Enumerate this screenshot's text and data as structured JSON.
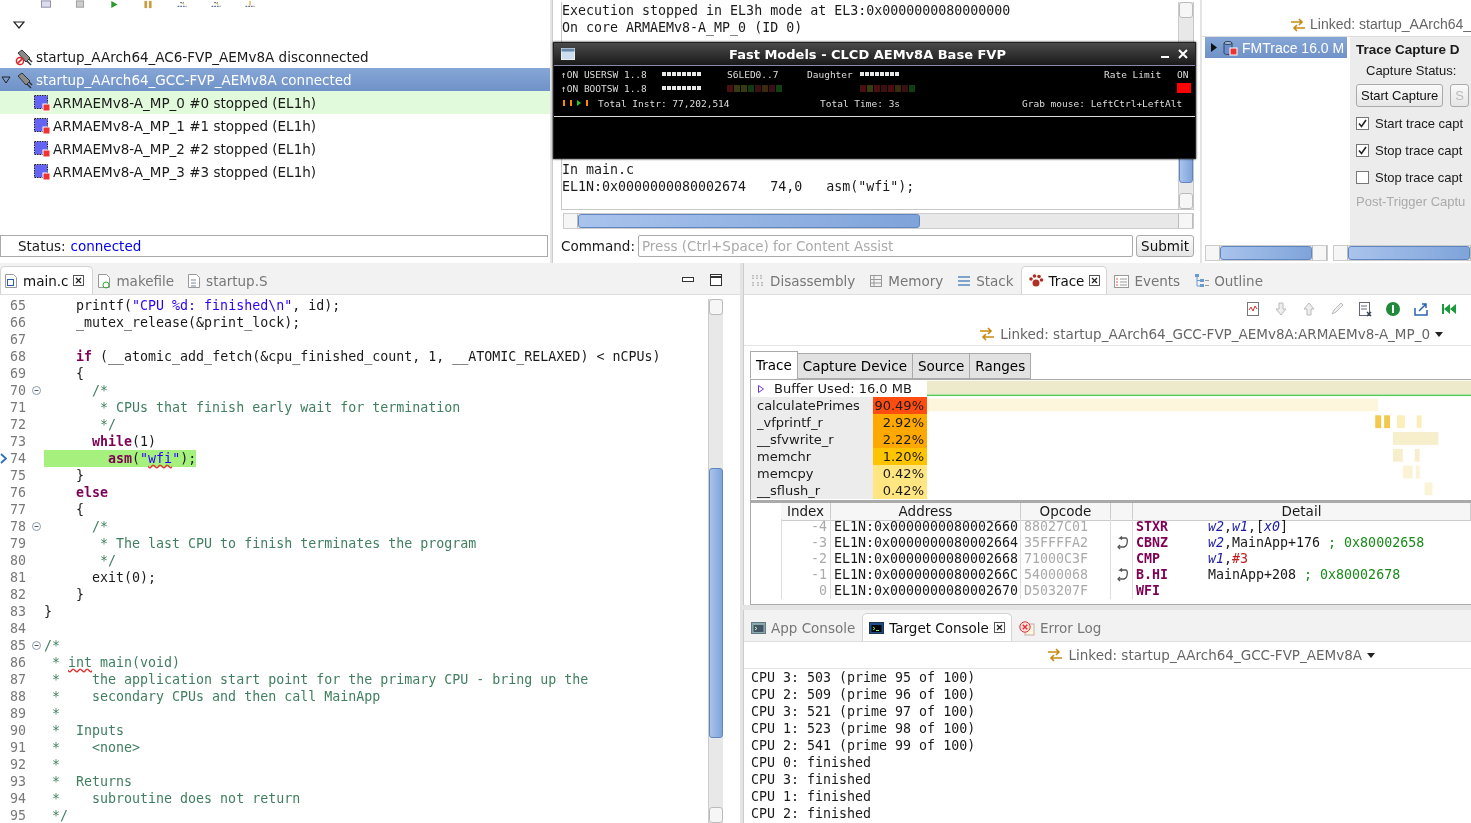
{
  "debug_control": {
    "connections": [
      {
        "name": "startup_AArch64_AC6-FVP_AEMv8A disconnected",
        "connected": false,
        "selected": false
      },
      {
        "name": "startup_AArch64_GCC-FVP_AEMv8A connected",
        "connected": true,
        "selected": true,
        "expanded": true,
        "children": [
          {
            "name": "ARMAEMv8-A_MP_0 #0 stopped (EL1h)",
            "current": true
          },
          {
            "name": "ARMAEMv8-A_MP_1 #1 stopped (EL1h)",
            "current": false
          },
          {
            "name": "ARMAEMv8-A_MP_2 #2 stopped (EL1h)",
            "current": false
          },
          {
            "name": "ARMAEMv8-A_MP_3 #3 stopped (EL1h)",
            "current": false
          }
        ]
      }
    ],
    "status": {
      "label": "Status:",
      "value": "connected"
    }
  },
  "command_view": {
    "log": [
      "Execution stopped in EL3h mode at EL3:0x0000000080000000",
      "On core ARMAEMv8-A_MP_0 (ID 0)"
    ],
    "log_below_window": [
      "In main.c",
      "EL1N:0x0000000080002674   74,0   asm(\"wfi\");"
    ],
    "command": {
      "label": "Command:",
      "placeholder": "Press (Ctrl+Space) for Content Assist"
    },
    "submit": "Submit"
  },
  "fvp_window": {
    "title": "Fast Models - CLCD AEMv8A Base FVP",
    "usersw": "↑ON USERSW 1..8",
    "bootsw": "↑ON BOOTSW 1..8",
    "s6led": "S6LED0..7",
    "daughter": "Daughter",
    "rate_limit": "Rate Limit",
    "rate_limit_state": "ON",
    "total_instr": "Total Instr: 77,202,514",
    "total_time": "Total Time:  3s",
    "grab_mouse": "Grab mouse: LeftCtrl+LeftAlt"
  },
  "trace_control": {
    "linked": "Linked: startup_AArch64_",
    "sources": [
      {
        "name": "FMTrace 16.0 M",
        "selected": true,
        "expanded": false
      }
    ],
    "heading": "Trace Capture D",
    "capture_status": "Capture Status:",
    "buttons": [
      {
        "label": "Start Capture",
        "disabled": false
      },
      {
        "label": "S",
        "disabled": true
      }
    ],
    "options": [
      {
        "label": "Start trace capt",
        "checked": true
      },
      {
        "label": "Stop trace capt",
        "checked": true
      },
      {
        "label": "Stop trace capt",
        "checked": false
      }
    ],
    "post_trigger": {
      "label": "Post-Trigger Captu",
      "disabled": true
    }
  },
  "editor": {
    "tabs": [
      {
        "label": "main.c",
        "kind": "c",
        "selected": true
      },
      {
        "label": "makefile",
        "kind": "make",
        "selected": false
      },
      {
        "label": "startup.S",
        "kind": "asm",
        "selected": false
      }
    ],
    "lines": [
      {
        "number": "65",
        "segments": [
          {
            "kind": "plain",
            "text": "    printf("
          },
          {
            "kind": "string",
            "text": "\"CPU %d: finished\\n\""
          },
          {
            "kind": "plain",
            "text": ", id);"
          }
        ]
      },
      {
        "number": "66",
        "segments": [
          {
            "kind": "plain",
            "text": "    _mutex_release(&print_lock);"
          }
        ]
      },
      {
        "number": "67"
      },
      {
        "number": "68",
        "segments": [
          {
            "kind": "keyword",
            "text": "    if"
          },
          {
            "kind": "plain",
            "text": " (__atomic_add_fetch(&cpu_finished_count, 1, __ATOMIC_RELAXED) < nCPUs)"
          }
        ]
      },
      {
        "number": "69",
        "segments": [
          {
            "kind": "plain",
            "text": "    {"
          }
        ]
      },
      {
        "number": "70",
        "fold": true,
        "segments": [
          {
            "kind": "comment",
            "text": "      /*"
          }
        ]
      },
      {
        "number": "71",
        "segments": [
          {
            "kind": "comment",
            "text": "       * CPUs that finish early wait for termination"
          }
        ]
      },
      {
        "number": "72",
        "segments": [
          {
            "kind": "comment",
            "text": "       */"
          }
        ]
      },
      {
        "number": "73",
        "segments": [
          {
            "kind": "keyword",
            "text": "      while"
          },
          {
            "kind": "plain",
            "text": "(1)"
          }
        ]
      },
      {
        "number": "74",
        "current": true,
        "segments": [
          {
            "kind": "keyword",
            "text": "        asm"
          },
          {
            "kind": "plain",
            "text": "("
          },
          {
            "kind": "string",
            "text": "\""
          },
          {
            "kind": "string_misspelled",
            "text": "wfi"
          },
          {
            "kind": "string",
            "text": "\""
          },
          {
            "kind": "plain",
            "text": ");"
          }
        ]
      },
      {
        "number": "75",
        "segments": [
          {
            "kind": "plain",
            "text": "    }"
          }
        ]
      },
      {
        "number": "76",
        "segments": [
          {
            "kind": "keyword",
            "text": "    else"
          }
        ]
      },
      {
        "number": "77",
        "segments": [
          {
            "kind": "plain",
            "text": "    {"
          }
        ]
      },
      {
        "number": "78",
        "fold": true,
        "segments": [
          {
            "kind": "comment",
            "text": "      /*"
          }
        ]
      },
      {
        "number": "79",
        "segments": [
          {
            "kind": "comment",
            "text": "       * The last CPU to finish terminates the program"
          }
        ]
      },
      {
        "number": "80",
        "segments": [
          {
            "kind": "comment",
            "text": "       */"
          }
        ]
      },
      {
        "number": "81",
        "segments": [
          {
            "kind": "plain",
            "text": "      exit(0);"
          }
        ]
      },
      {
        "number": "82",
        "segments": [
          {
            "kind": "plain",
            "text": "    }"
          }
        ]
      },
      {
        "number": "83",
        "segments": [
          {
            "kind": "plain",
            "text": "}"
          }
        ]
      },
      {
        "number": "84"
      },
      {
        "number": "85",
        "fold": true,
        "segments": [
          {
            "kind": "comment",
            "text": "/*"
          }
        ]
      },
      {
        "number": "86",
        "segments": [
          {
            "kind": "comment",
            "text": " * "
          },
          {
            "kind": "comment_misspelled",
            "text": "int"
          },
          {
            "kind": "comment",
            "text": " main(void)"
          }
        ]
      },
      {
        "number": "87",
        "segments": [
          {
            "kind": "comment",
            "text": " *    the application start point for the primary CPU - bring up the"
          }
        ]
      },
      {
        "number": "88",
        "segments": [
          {
            "kind": "comment",
            "text": " *    secondary CPUs and then call MainApp"
          }
        ]
      },
      {
        "number": "89",
        "segments": [
          {
            "kind": "comment",
            "text": " *"
          }
        ]
      },
      {
        "number": "90",
        "segments": [
          {
            "kind": "comment",
            "text": " *  Inputs"
          }
        ]
      },
      {
        "number": "91",
        "segments": [
          {
            "kind": "comment",
            "text": " *    <none>"
          }
        ]
      },
      {
        "number": "92",
        "segments": [
          {
            "kind": "comment",
            "text": " *"
          }
        ]
      },
      {
        "number": "93",
        "segments": [
          {
            "kind": "comment",
            "text": " *  Returns"
          }
        ]
      },
      {
        "number": "94",
        "segments": [
          {
            "kind": "comment",
            "text": " *    subroutine does not return"
          }
        ]
      },
      {
        "number": "95",
        "segments": [
          {
            "kind": "comment",
            "text": " */"
          }
        ]
      }
    ]
  },
  "trace_view": {
    "tabs": [
      {
        "label": "Disassembly",
        "kind": "disassembly",
        "selected": false
      },
      {
        "label": "Memory",
        "kind": "memory",
        "selected": false
      },
      {
        "label": "Stack",
        "kind": "stack",
        "selected": false
      },
      {
        "label": "Trace",
        "kind": "trace",
        "selected": true
      },
      {
        "label": "Events",
        "kind": "events",
        "selected": false
      },
      {
        "label": "Outline",
        "kind": "outline",
        "selected": false
      }
    ],
    "linked": "Linked: startup_AArch64_GCC-FVP_AEMv8A:ARMAEMv8-A_MP_0",
    "subtabs": [
      {
        "label": "Trace",
        "selected": true
      },
      {
        "label": "Capture Device",
        "selected": false
      },
      {
        "label": "Source",
        "selected": false
      },
      {
        "label": "Ranges",
        "selected": false
      }
    ],
    "buffer": "Buffer Used: 16.0 MB",
    "functions": [
      {
        "name": "calculatePrimes",
        "percent": "90.49%",
        "color": "#ff4d12"
      },
      {
        "name": "_vfprintf_r",
        "percent": "2.92%",
        "color": "#ffa800"
      },
      {
        "name": "__sfvwrite_r",
        "percent": "2.22%",
        "color": "#ffa800"
      },
      {
        "name": "memchr",
        "percent": "1.20%",
        "color": "#ffc400"
      },
      {
        "name": "memcpy",
        "percent": "0.42%",
        "color": "#ffe680"
      },
      {
        "name": "__sflush_r",
        "percent": "0.42%",
        "color": "#ffe680"
      }
    ],
    "table": {
      "columns": [
        "Index",
        "Address",
        "Opcode",
        "Detail"
      ],
      "rows": [
        {
          "index": "-4",
          "address": "EL1N:0x0000000080002660",
          "opcode": "88027C01",
          "branch": false,
          "mnemonic": "STXR",
          "operands": [
            {
              "kind": "reg",
              "text": "w2"
            },
            {
              "kind": "plain",
              "text": ","
            },
            {
              "kind": "reg",
              "text": "w1"
            },
            {
              "kind": "plain",
              "text": ",["
            },
            {
              "kind": "reg",
              "text": "x0"
            },
            {
              "kind": "plain",
              "text": "]"
            }
          ]
        },
        {
          "index": "-3",
          "address": "EL1N:0x0000000080002664",
          "opcode": "35FFFFA2",
          "branch": true,
          "mnemonic": "CBNZ",
          "operands": [
            {
              "kind": "reg",
              "text": "w2"
            },
            {
              "kind": "plain",
              "text": ",MainApp+176 "
            },
            {
              "kind": "comment",
              "text": "; 0x80002658"
            }
          ]
        },
        {
          "index": "-2",
          "address": "EL1N:0x0000000080002668",
          "opcode": "71000C3F",
          "branch": false,
          "mnemonic": "CMP",
          "operands": [
            {
              "kind": "reg",
              "text": "w1"
            },
            {
              "kind": "plain",
              "text": ","
            },
            {
              "kind": "imm",
              "text": "#3"
            }
          ]
        },
        {
          "index": "-1",
          "address": "EL1N:0x000000008000266C",
          "opcode": "54000068",
          "branch": true,
          "mnemonic": "B.HI",
          "operands": [
            {
              "kind": "plain",
              "text": "MainApp+208 "
            },
            {
              "kind": "comment",
              "text": "; 0x80002678"
            }
          ]
        },
        {
          "index": "0",
          "address": "EL1N:0x0000000080002670",
          "opcode": "D503207F",
          "branch": false,
          "mnemonic": "WFI"
        }
      ]
    }
  },
  "console": {
    "tabs": [
      {
        "label": "App Console",
        "kind": "app",
        "selected": false
      },
      {
        "label": "Target Console",
        "kind": "target",
        "selected": true
      },
      {
        "label": "Error Log",
        "kind": "error",
        "selected": false
      }
    ],
    "linked": "Linked: startup_AArch64_GCC-FVP_AEMv8A",
    "lines": [
      "CPU 3: 503 (prime 95 of 100)",
      "CPU 2: 509 (prime 96 of 100)",
      "CPU 3: 521 (prime 97 of 100)",
      "CPU 1: 523 (prime 98 of 100)",
      "CPU 2: 541 (prime 99 of 100)",
      "CPU 0: finished",
      "CPU 3: finished",
      "CPU 1: finished",
      "CPU 2: finished"
    ]
  }
}
